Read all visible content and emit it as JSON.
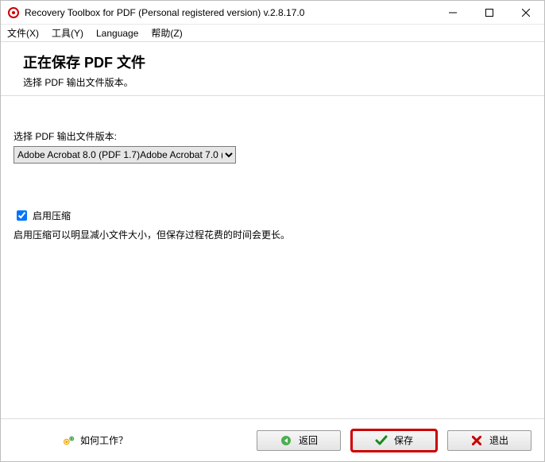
{
  "window": {
    "title": "Recovery Toolbox for PDF (Personal registered version) v.2.8.17.0"
  },
  "menu": {
    "file": "文件(X)",
    "tools": "工具(Y)",
    "language": "Language",
    "help": "帮助(Z)"
  },
  "header": {
    "title": "正在保存 PDF 文件",
    "subtitle": "选择 PDF 输出文件版本。"
  },
  "form": {
    "version_label": "选择 PDF 输出文件版本:",
    "version_selected": "Adobe Acrobat 8.0 (PDF 1.7)Adobe Acrobat 7.0 (PI",
    "compress_checked": true,
    "compress_label": "启用压缩",
    "compress_hint": "启用压缩可以明显减小文件大小，但保存过程花费的时间会更长。"
  },
  "footer": {
    "how_link": "如何工作？",
    "back": "返回",
    "save": "保存",
    "exit": "退出"
  }
}
